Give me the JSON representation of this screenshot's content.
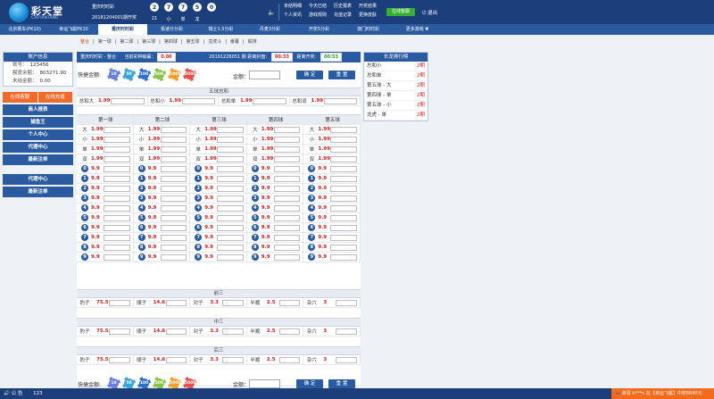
{
  "brand": {
    "name": "彩天堂",
    "sub": "CAITIANTANG"
  },
  "lottery": {
    "name": "重庆时时彩",
    "issue_label": "20181204001期开奖",
    "balls": [
      "2",
      "7",
      "7",
      "5",
      "0"
    ],
    "ball_labels": [
      "21",
      "小",
      "单",
      "龙"
    ]
  },
  "topnav": [
    [
      "未结明细",
      "今天已结",
      "历史报表",
      "开奖结果"
    ],
    [
      "个人资讯",
      "游戏规则",
      "充值记录",
      "更换皮肤"
    ]
  ],
  "online_label": "在线客服",
  "logout_label": "退出",
  "tabs": [
    "北京赛车(PK10)",
    "幸运飞艇PK10",
    "重庆时时彩",
    "极速分分彩",
    "瑞士1.5分彩",
    "丹麦3分彩",
    "开奖5分彩",
    "澳门时时彩",
    "更多游戏 ▼"
  ],
  "active_tab": 2,
  "subtabs": [
    "整合",
    "第一球",
    "第二球",
    "第三球",
    "第四球",
    "第五球",
    "龙虎斗",
    "番薯",
    "骰排"
  ],
  "account": {
    "title": "账户信息",
    "rows": [
      {
        "k": "账号：",
        "v": "123456"
      },
      {
        "k": "额度余额：",
        "v": "803271.90"
      },
      {
        "k": "未结金额：",
        "v": "0.00"
      }
    ],
    "orange_buttons": [
      "在线客服",
      "在线充值"
    ],
    "buttons": [
      "商人报表",
      "捕鱼王",
      "个人中心",
      "代理中心",
      "最新注单"
    ],
    "buttons2": [
      "代理中心",
      "最新注单"
    ]
  },
  "infobar": {
    "lottery": "重庆时时彩 - 整合",
    "win_label": "当前彩种输赢：",
    "win_value": "0.00",
    "issue": "20191228051 期",
    "close_label": "距离封盘：",
    "close_time": "00:33",
    "open_label": "距离开奖：",
    "open_time": "00:53"
  },
  "chips": {
    "label": "快捷金额:",
    "values": [
      "10",
      "50",
      "100",
      "500",
      "1000",
      "5000"
    ],
    "amount_label": "金额：",
    "confirm": "确 定",
    "reset": "重 置"
  },
  "sum": {
    "title": "五球总和",
    "cells": [
      {
        "l": "总和大",
        "o": "1.99"
      },
      {
        "l": "总和小",
        "o": "1.99"
      },
      {
        "l": "总和单",
        "o": "1.99"
      },
      {
        "l": "总和双",
        "o": "1.99"
      }
    ]
  },
  "balls_section": {
    "headers": [
      "第一球",
      "第二球",
      "第三球",
      "第四球",
      "第五球"
    ],
    "labels": [
      "大",
      "小",
      "单",
      "双"
    ],
    "label_odds": "1.99",
    "numbers": [
      "0",
      "1",
      "2",
      "3",
      "4",
      "5",
      "6",
      "7",
      "8",
      "9"
    ],
    "num_odds": "9.9"
  },
  "combo": [
    {
      "title": "前三"
    },
    {
      "title": "中三"
    },
    {
      "title": "后三"
    }
  ],
  "combo_cells": [
    {
      "l": "豹子",
      "o": "75.5"
    },
    {
      "l": "顺子",
      "o": "14.6"
    },
    {
      "l": "对子",
      "o": "3.3"
    },
    {
      "l": "半顺",
      "o": "2.5"
    },
    {
      "l": "杂六",
      "o": "3"
    }
  ],
  "ranking": {
    "title": "长龙排行榜",
    "rows": [
      {
        "k": "总和小",
        "v": "2期"
      },
      {
        "k": "总和单",
        "v": "2期"
      },
      {
        "k": "第五球 - 大",
        "v": "2期"
      },
      {
        "k": "第四球 - 单",
        "v": "2期"
      },
      {
        "k": "第五球 - 小",
        "v": "2期"
      },
      {
        "k": "龙虎 - 单",
        "v": "2期"
      }
    ]
  },
  "footer": {
    "notice_label": "公 告",
    "notice": "123",
    "ticker": "恭喜 h***n 在【幸运飞艇】中奖8840元"
  },
  "colors": {
    "primary": "#1c3f7c",
    "accent": "#f06a2a",
    "odds": "#d02020"
  }
}
